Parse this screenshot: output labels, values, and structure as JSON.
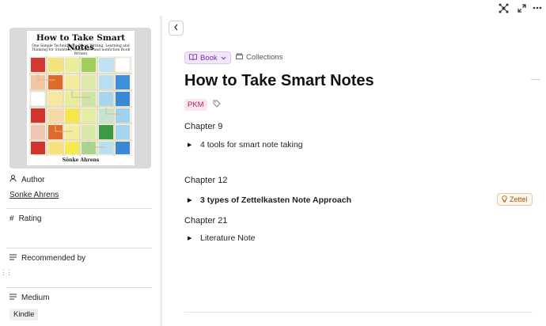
{
  "toolbar": {
    "icons": [
      "graph-icon",
      "expand-icon",
      "more-icon"
    ]
  },
  "cover": {
    "title": "How to Take Smart Notes",
    "subtitle": "One Simple Technique to Boost Writing, Learning and Thinking for Students, Academics and nonfiction Book Writers",
    "author": "Sönke Ahrens"
  },
  "properties": {
    "author": {
      "label": "Author",
      "value": "Sonke Ahrens"
    },
    "rating": {
      "label": "Rating"
    },
    "recommended": {
      "label": "Recommended by"
    },
    "medium": {
      "label": "Medium",
      "value": "Kindle"
    }
  },
  "page": {
    "type_label": "Book",
    "collections_label": "Collections",
    "title": "How to Take Smart Notes",
    "tag": "PKM",
    "sections": [
      {
        "chapter": "Chapter 9",
        "toggle": "4 tools for smart note taking"
      },
      {
        "chapter": "Chapter 12",
        "toggle": "3 types of Zettelkasten Note Approach",
        "badge": "Zettel"
      },
      {
        "chapter": "Chapter 21",
        "toggle": "Literature Note"
      }
    ]
  },
  "colors": {
    "type_pill": "#7b2ba6",
    "tag_pkm": "#b0245c",
    "badge_zettel": "#a05b12"
  }
}
